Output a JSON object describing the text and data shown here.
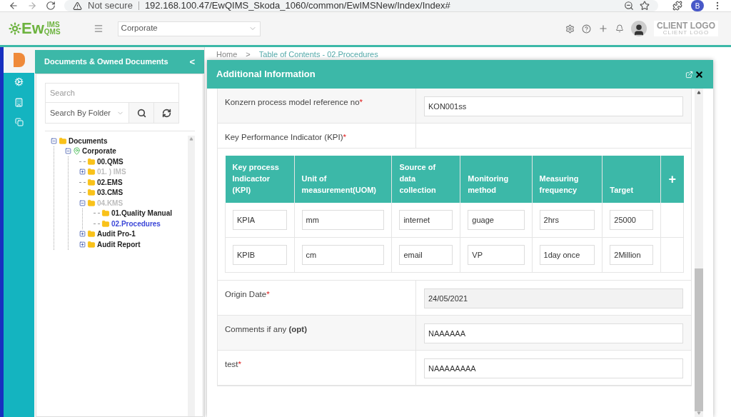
{
  "browser": {
    "security": "Not secure",
    "url": "192.168.100.47/EwQIMS_Skoda_1060/common/EwIMSNew/Index/Index#",
    "profile": "B"
  },
  "header": {
    "logo_main": "Ew",
    "logo_top": "IMS",
    "logo_bottom": "QMS",
    "org_select": "Corporate",
    "client_logo": "CLIENT LOGO",
    "client_logo_sub": "CLIENT LOGO"
  },
  "sidebar": {
    "title": "Documents & Owned Documents",
    "collapse": "<",
    "search": {
      "placeholder": "Search"
    },
    "search_by": "Search By Folder",
    "tree": [
      {
        "label": "Documents",
        "kind": "folder",
        "expanded": true,
        "disabled": false,
        "selected": false,
        "children": [
          {
            "label": "Corporate",
            "kind": "location",
            "expanded": true,
            "disabled": false,
            "selected": false,
            "children": [
              {
                "label": "00.QMS",
                "kind": "folder",
                "disabled": false,
                "selected": false
              },
              {
                "label": "01. ) IMS",
                "kind": "folder",
                "expanded": false,
                "disabled": true,
                "selected": false
              },
              {
                "label": "02.EMS",
                "kind": "folder",
                "disabled": false,
                "selected": false
              },
              {
                "label": "03.CMS",
                "kind": "folder",
                "disabled": false,
                "selected": false
              },
              {
                "label": "04.KMS",
                "kind": "folder",
                "expanded": true,
                "disabled": true,
                "selected": false,
                "children": [
                  {
                    "label": "01.Quality Manual",
                    "kind": "folder",
                    "disabled": false,
                    "selected": false
                  },
                  {
                    "label": "02.Procedures",
                    "kind": "folder",
                    "disabled": false,
                    "selected": true
                  }
                ]
              },
              {
                "label": "Audit Pro-1",
                "kind": "folder",
                "expanded": false,
                "disabled": false,
                "selected": false
              },
              {
                "label": "Audit Report",
                "kind": "folder",
                "expanded": false,
                "disabled": false,
                "selected": false
              }
            ]
          }
        ]
      }
    ]
  },
  "breadcrumb": [
    "Home",
    ">",
    "Table of Contents - 02.Procedures"
  ],
  "modal": {
    "title": "Additional Information",
    "rows": [
      {
        "kind": "text",
        "label": "Konzern process model reference no",
        "required_mark": "*",
        "value": "KON001ss"
      },
      {
        "kind": "header",
        "label": "Key Performance Indicator (KPI)",
        "required_mark": "*"
      },
      {
        "kind": "kpi_table",
        "columns": [
          "Key process Indicactor (KPI)",
          "Unit of measurement(UOM)",
          "Source of data collection",
          "Monitoring method",
          "Measuring frequency",
          "Target"
        ],
        "add": "+",
        "rows": [
          [
            "KPIA",
            "mm",
            "internet",
            "guage",
            "2hrs",
            "25000"
          ],
          [
            "KPIB",
            "cm",
            "email",
            "VP",
            "1day once",
            "2Million"
          ]
        ]
      },
      {
        "kind": "readonly",
        "label": "Origin Date",
        "required_mark": "*",
        "value": "24/05/2021"
      },
      {
        "kind": "text",
        "label": "Comments if any **(opt)**",
        "value": "NAAAAAA"
      },
      {
        "kind": "text",
        "label": "test",
        "required_mark": "*",
        "value": "NAAAAAAAA"
      }
    ]
  }
}
